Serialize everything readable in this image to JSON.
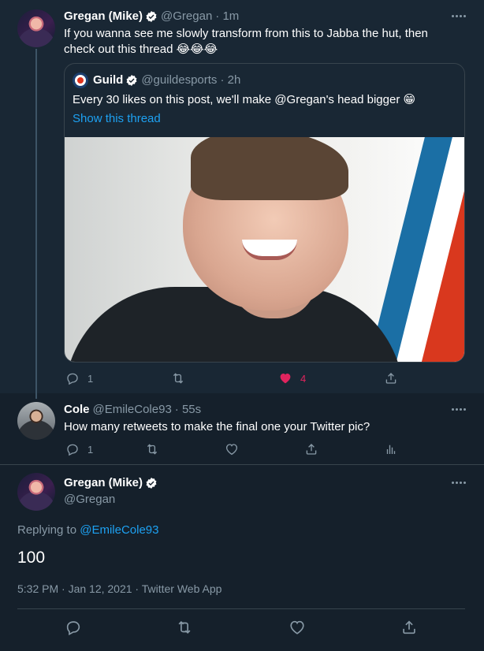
{
  "colors": {
    "background": "#15202b",
    "highlight_background": "#192734",
    "accent": "#1da1f2",
    "muted": "#8899a6",
    "like": "#e0245e"
  },
  "tweet1": {
    "name": "Gregan (Mike)",
    "handle": "@Gregan",
    "time": "· 1m",
    "text": "If you wanna see me slowly transform from this to Jabba the hut, then check out this thread 😂😂😂",
    "quote": {
      "name": "Guild",
      "handle": "@guildesports",
      "time": "· 2h",
      "text": "Every 30 likes on this post, we'll make @Gregan's head bigger 😁",
      "show_thread": "Show this thread"
    },
    "actions": {
      "reply_count": "1",
      "retweet_count": "",
      "like_count": "4"
    }
  },
  "tweet2": {
    "name": "Cole",
    "handle": "@EmileCole93",
    "time": "· 55s",
    "text": "How many retweets to make the final one your Twitter pic?",
    "actions": {
      "reply_count": "1"
    }
  },
  "tweet3": {
    "name": "Gregan (Mike)",
    "handle": "@Gregan",
    "replying_label": "Replying to ",
    "replying_handle": "@EmileCole93",
    "text": "100",
    "meta": "5:32 PM · Jan 12, 2021 · Twitter Web App"
  },
  "icons": {
    "reply": "reply-icon",
    "retweet": "retweet-icon",
    "like": "heart-icon",
    "share": "share-icon",
    "analytics": "analytics-icon",
    "more": "more-icon",
    "verified": "verified-badge-icon"
  }
}
